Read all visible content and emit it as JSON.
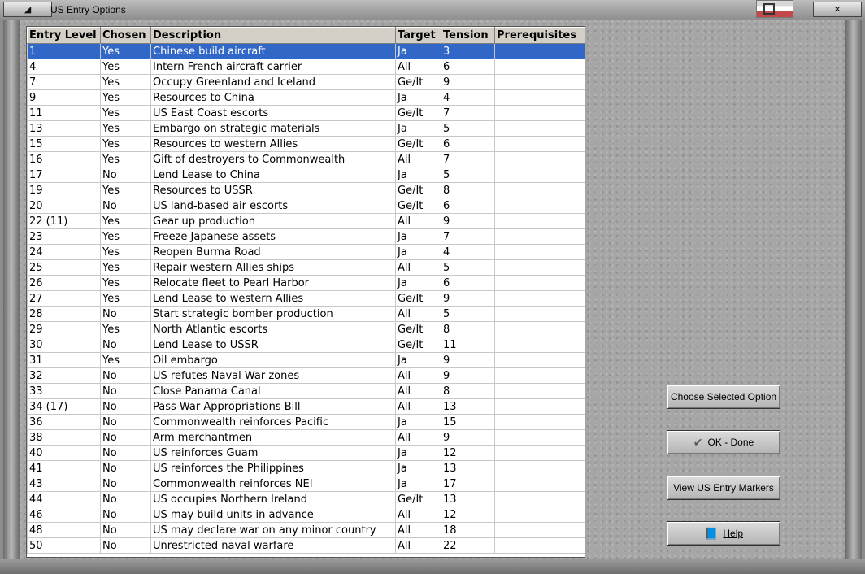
{
  "window": {
    "title": "US Entry Options"
  },
  "columns": [
    "Entry Level",
    "Chosen",
    "Description",
    "Target",
    "Tension",
    "Prerequisites"
  ],
  "rows": [
    [
      "1",
      "Yes",
      "Chinese build aircraft",
      "Ja",
      "3",
      ""
    ],
    [
      "4",
      "Yes",
      "Intern French aircraft carrier",
      "All",
      "6",
      ""
    ],
    [
      "7",
      "Yes",
      "Occupy Greenland and Iceland",
      "Ge/It",
      "9",
      ""
    ],
    [
      "9",
      "Yes",
      "Resources to China",
      "Ja",
      "4",
      ""
    ],
    [
      "11",
      "Yes",
      "US East Coast escorts",
      "Ge/It",
      "7",
      ""
    ],
    [
      "13",
      "Yes",
      "Embargo on strategic materials",
      "Ja",
      "5",
      ""
    ],
    [
      "15",
      "Yes",
      "Resources to western Allies",
      "Ge/It",
      "6",
      ""
    ],
    [
      "16",
      "Yes",
      "Gift of destroyers to Commonwealth",
      "All",
      "7",
      ""
    ],
    [
      "17",
      "No",
      "Lend Lease to China",
      "Ja",
      "5",
      ""
    ],
    [
      "19",
      "Yes",
      "Resources to USSR",
      "Ge/It",
      "8",
      ""
    ],
    [
      "20",
      "No",
      "US land-based air escorts",
      "Ge/It",
      "6",
      ""
    ],
    [
      "22 (11)",
      "Yes",
      "Gear up production",
      "All",
      "9",
      ""
    ],
    [
      "23",
      "Yes",
      "Freeze Japanese assets",
      "Ja",
      "7",
      ""
    ],
    [
      "24",
      "Yes",
      "Reopen Burma Road",
      "Ja",
      "4",
      ""
    ],
    [
      "25",
      "Yes",
      "Repair western Allies ships",
      "All",
      "5",
      ""
    ],
    [
      "26",
      "Yes",
      "Relocate fleet to Pearl Harbor",
      "Ja",
      "6",
      ""
    ],
    [
      "27",
      "Yes",
      "Lend Lease to western Allies",
      "Ge/It",
      "9",
      ""
    ],
    [
      "28",
      "No",
      "Start strategic bomber production",
      "All",
      "5",
      ""
    ],
    [
      "29",
      "Yes",
      "North Atlantic escorts",
      "Ge/It",
      "8",
      ""
    ],
    [
      "30",
      "No",
      "Lend Lease to USSR",
      "Ge/It",
      "11",
      ""
    ],
    [
      "31",
      "Yes",
      "Oil embargo",
      "Ja",
      "9",
      ""
    ],
    [
      "32",
      "No",
      "US refutes Naval War zones",
      "All",
      "9",
      ""
    ],
    [
      "33",
      "No",
      "Close Panama Canal",
      "All",
      "8",
      ""
    ],
    [
      "34 (17)",
      "No",
      "Pass War Appropriations Bill",
      "All",
      "13",
      ""
    ],
    [
      "36",
      "No",
      "Commonwealth reinforces Pacific",
      "Ja",
      "15",
      ""
    ],
    [
      "38",
      "No",
      "Arm merchantmen",
      "All",
      "9",
      ""
    ],
    [
      "40",
      "No",
      "US reinforces Guam",
      "Ja",
      "12",
      ""
    ],
    [
      "41",
      "No",
      "US reinforces the Philippines",
      "Ja",
      "13",
      ""
    ],
    [
      "43",
      "No",
      "Commonwealth reinforces NEI",
      "Ja",
      "17",
      ""
    ],
    [
      "44",
      "No",
      "US occupies Northern Ireland",
      "Ge/It",
      "13",
      ""
    ],
    [
      "46",
      "No",
      "US may build units in advance",
      "All",
      "12",
      ""
    ],
    [
      "48",
      "No",
      "US may declare war on any minor country",
      "All",
      "18",
      ""
    ],
    [
      "50",
      "No",
      "Unrestricted naval warfare",
      "All",
      "22",
      ""
    ]
  ],
  "selected_row": 0,
  "buttons": {
    "choose": "Choose Selected Option",
    "ok": "OK - Done",
    "view_markers": "View US Entry Markers",
    "help": "Help"
  },
  "icons": {
    "ok": "checkmark-icon",
    "help": "help-book-icon",
    "minimize": "minimize-icon",
    "close": "close-icon"
  },
  "colors": {
    "selection": "#3167c6",
    "header": "#d4d0c8"
  }
}
